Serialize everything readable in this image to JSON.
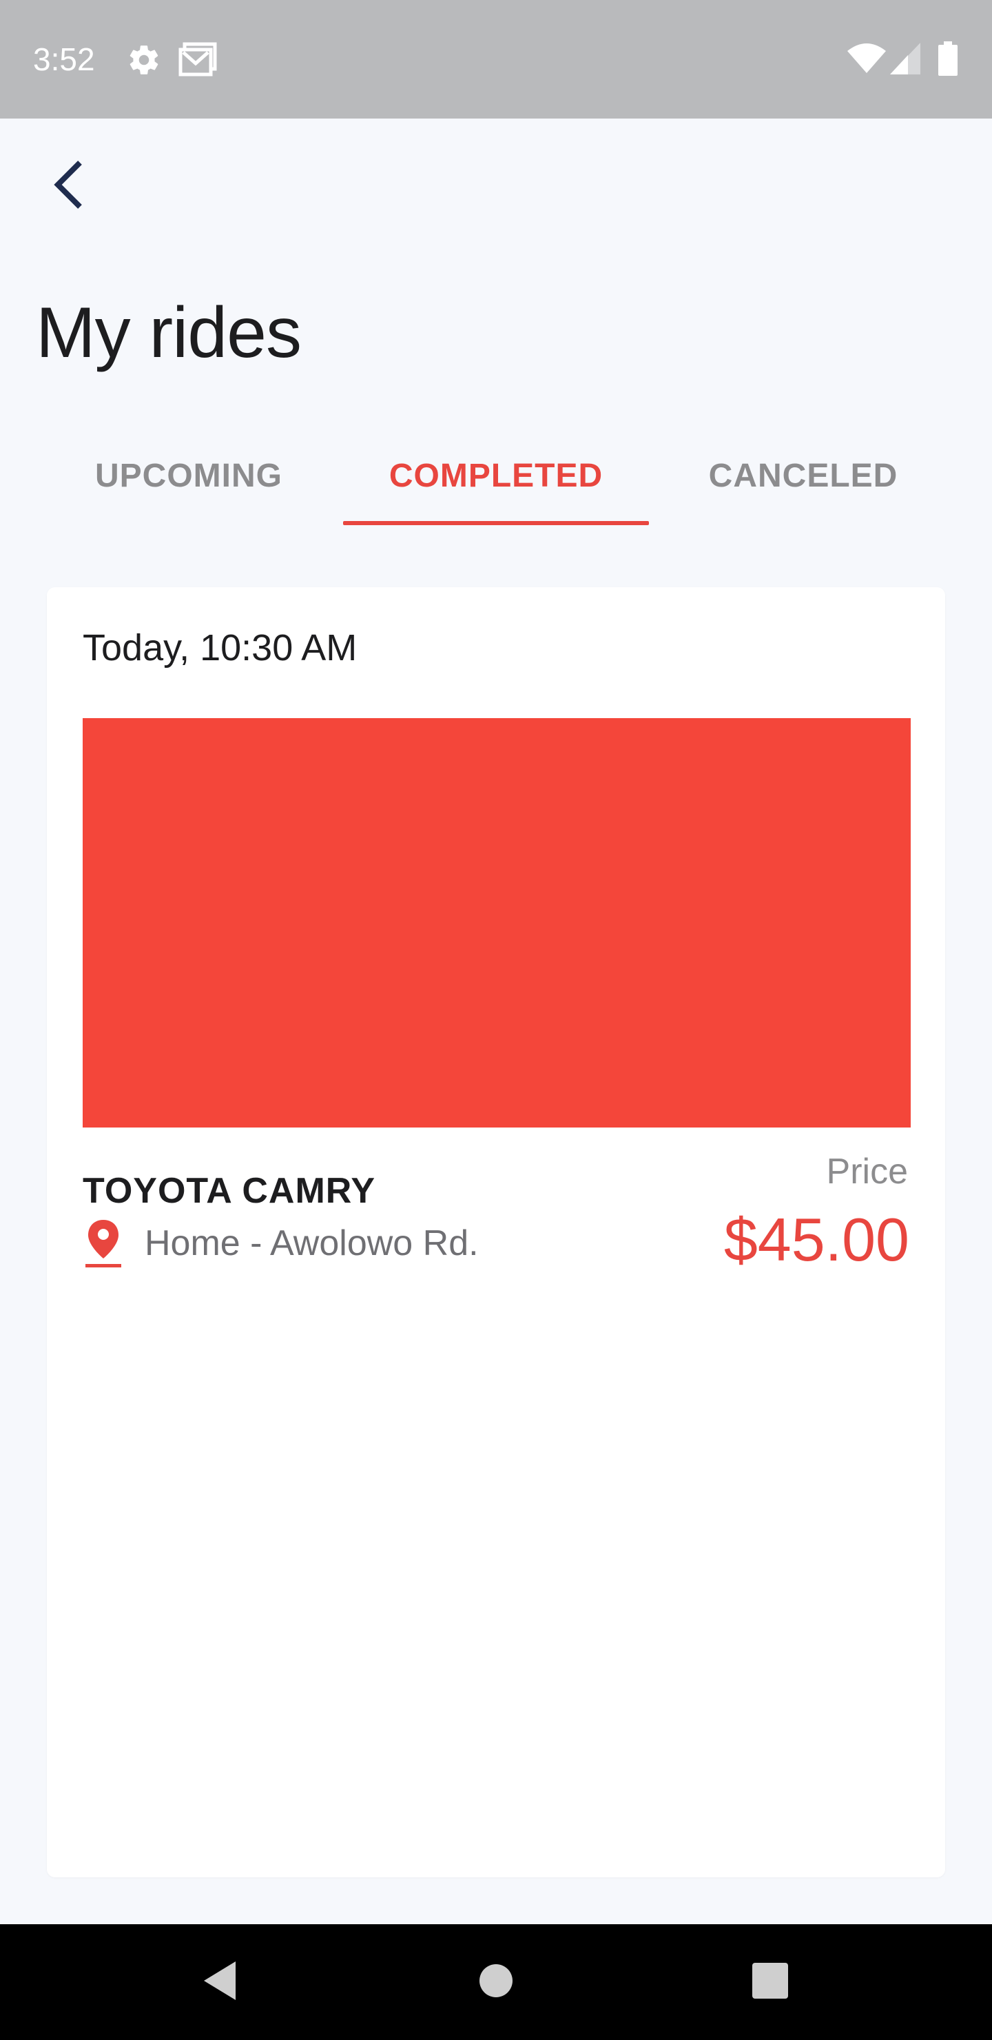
{
  "status_bar": {
    "time": "3:52",
    "icons": [
      "gear-icon",
      "gmail-icon",
      "wifi-icon",
      "signal-icon",
      "battery-icon"
    ]
  },
  "header": {
    "back_icon": "chevron-left-icon",
    "title": "My rides"
  },
  "tabs": [
    {
      "label": "UPCOMING",
      "active": false
    },
    {
      "label": "COMPLETED",
      "active": true
    },
    {
      "label": "CANCELED",
      "active": false
    }
  ],
  "ride": {
    "date": "Today, 10:30 AM",
    "car": "TOYOTA CAMRY",
    "route": "Home - Awolowo Rd.",
    "price_label": "Price",
    "price": "$45.00",
    "map_color": "#f4463a"
  },
  "colors": {
    "accent": "#e8463f",
    "status_bar": "#b9babc",
    "background": "#f6f8fc"
  },
  "nav_bar": {
    "icons": [
      "back-triangle-icon",
      "home-circle-icon",
      "recents-square-icon"
    ]
  }
}
